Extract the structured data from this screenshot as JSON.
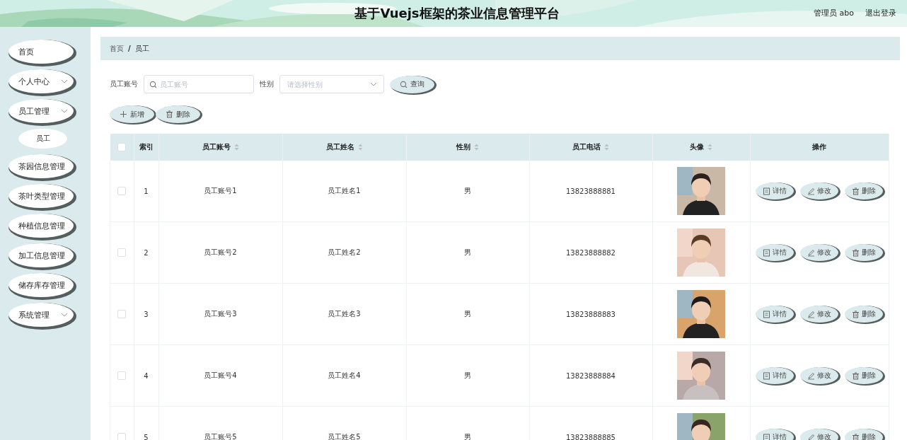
{
  "header": {
    "title": "基于Vuejs框架的茶业信息管理平台",
    "user": "管理员 abo",
    "logout": "退出登录"
  },
  "sidebar": {
    "items": [
      {
        "label": "首页",
        "has_submenu": false
      },
      {
        "label": "个人中心",
        "has_submenu": true
      },
      {
        "label": "员工管理",
        "has_submenu": true,
        "children": [
          {
            "label": "员工"
          }
        ]
      },
      {
        "label": "茶园信息管理",
        "has_submenu": false
      },
      {
        "label": "茶叶类型管理",
        "has_submenu": false
      },
      {
        "label": "种植信息管理",
        "has_submenu": false
      },
      {
        "label": "加工信息管理",
        "has_submenu": false
      },
      {
        "label": "储存库存管理",
        "has_submenu": false
      },
      {
        "label": "系统管理",
        "has_submenu": true
      }
    ]
  },
  "breadcrumb": [
    "首页",
    "员工"
  ],
  "breadcrumb_separator": "/",
  "search": {
    "account_label": "员工账号",
    "account_placeholder": "员工账号",
    "gender_label": "性别",
    "gender_placeholder": "请选择性别",
    "query_button": "查询"
  },
  "actions": [
    {
      "kind": "add",
      "label": "新增"
    },
    {
      "kind": "delete",
      "label": "删除"
    }
  ],
  "table": {
    "columns": [
      {
        "kind": "check",
        "checked": false
      },
      {
        "label": "索引",
        "sortable": false
      },
      {
        "label": "员工账号",
        "sortable": true
      },
      {
        "label": "员工姓名",
        "sortable": true
      },
      {
        "label": "性别",
        "sortable": true
      },
      {
        "label": "员工电话",
        "sortable": true
      },
      {
        "label": "头像",
        "sortable": true
      },
      {
        "label": "操作",
        "sortable": false
      }
    ],
    "rows": [
      {
        "checked": false,
        "index": "1",
        "account": "员工账号1",
        "name": "员工姓名1",
        "gender": "男",
        "phone": "13823888881",
        "actions": [
          {
            "kind": "detail",
            "label": "详情"
          },
          {
            "kind": "edit",
            "label": "修改"
          },
          {
            "kind": "delete",
            "label": "删除"
          }
        ]
      },
      {
        "checked": false,
        "index": "2",
        "account": "员工账号2",
        "name": "员工姓名2",
        "gender": "男",
        "phone": "13823888882",
        "actions": [
          {
            "kind": "detail",
            "label": "详情"
          },
          {
            "kind": "edit",
            "label": "修改"
          },
          {
            "kind": "delete",
            "label": "删除"
          }
        ]
      },
      {
        "checked": false,
        "index": "3",
        "account": "员工账号3",
        "name": "员工姓名3",
        "gender": "男",
        "phone": "13823888883",
        "actions": [
          {
            "kind": "detail",
            "label": "详情"
          },
          {
            "kind": "edit",
            "label": "修改"
          },
          {
            "kind": "delete",
            "label": "删除"
          }
        ]
      },
      {
        "checked": false,
        "index": "4",
        "account": "员工账号4",
        "name": "员工姓名4",
        "gender": "男",
        "phone": "13823888884",
        "actions": [
          {
            "kind": "detail",
            "label": "详情"
          },
          {
            "kind": "edit",
            "label": "修改"
          },
          {
            "kind": "delete",
            "label": "删除"
          }
        ]
      },
      {
        "checked": false,
        "index": "5",
        "account": "员工账号5",
        "name": "员工姓名5",
        "gender": "男",
        "phone": "13823888885",
        "actions": [
          {
            "kind": "detail",
            "label": "详情"
          },
          {
            "kind": "edit",
            "label": "修改"
          },
          {
            "kind": "delete",
            "label": "删除"
          }
        ]
      }
    ]
  }
}
